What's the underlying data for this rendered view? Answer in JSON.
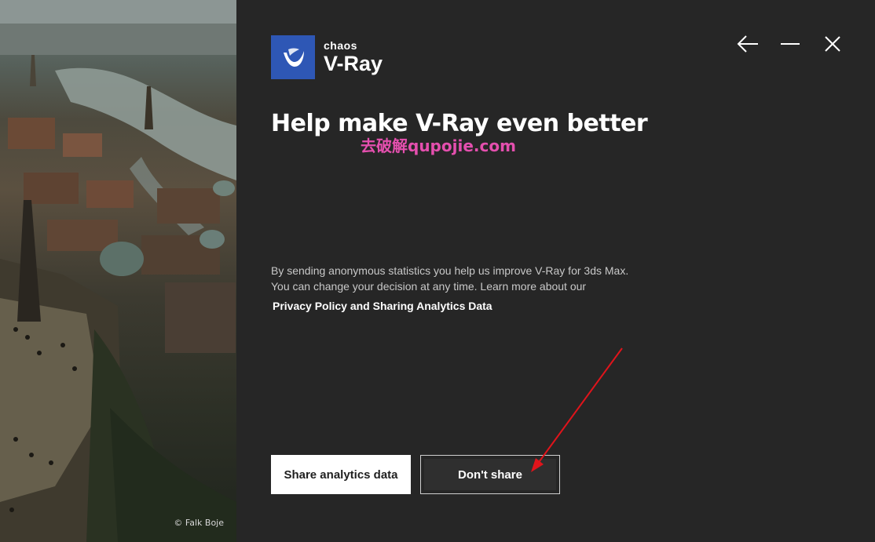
{
  "hero": {
    "credit": "© Falk Boje"
  },
  "logo": {
    "brand": "chaos",
    "product": "V-Ray",
    "color": "#2e57b5"
  },
  "window_controls": {
    "back_icon": "arrow-left-icon",
    "minimize_icon": "minimize-icon",
    "close_icon": "close-icon"
  },
  "main": {
    "title": "Help make V-Ray even better",
    "watermark": "去破解qupojie.com",
    "description_line1": "By sending anonymous statistics you help us improve V-Ray for 3ds Max.",
    "description_line2": "You can change your decision at any time. Learn more about our",
    "privacy_link": "Privacy Policy and Sharing Analytics Data"
  },
  "actions": {
    "share_label": "Share analytics data",
    "dont_share_label": "Don't share"
  },
  "colors": {
    "background": "#262626",
    "accent": "#2e57b5",
    "annotation_arrow": "#e0141b",
    "watermark": "#e44fae"
  }
}
